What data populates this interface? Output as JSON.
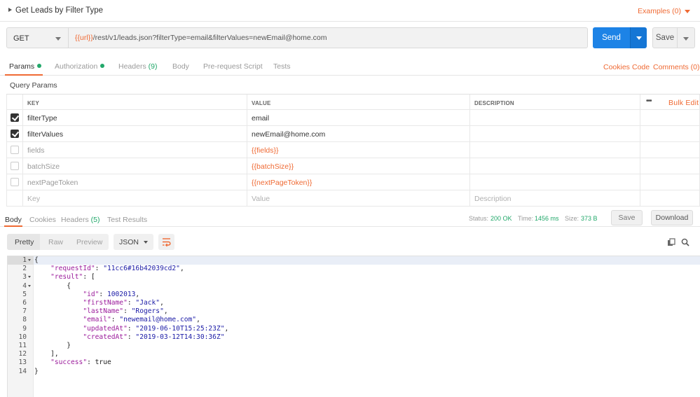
{
  "request": {
    "title": "Get Leads by Filter Type",
    "examples_label": "Examples (0)",
    "method": "GET",
    "url_var": "{{url}}",
    "url_path": "/rest/v1/leads.json?filterType=email&filterValues=newEmail@home.com",
    "send_label": "Send",
    "save_label": "Save"
  },
  "req_tabs": {
    "params": "Params",
    "authorization": "Authorization",
    "headers": "Headers",
    "headers_count": "(9)",
    "body": "Body",
    "prerequest": "Pre-request Script",
    "tests": "Tests",
    "cookies": "Cookies",
    "code": "Code",
    "comments": "Comments (0)"
  },
  "params": {
    "section_label": "Query Params",
    "columns": {
      "key": "KEY",
      "value": "VALUE",
      "description": "DESCRIPTION"
    },
    "more_label": "•••",
    "bulk_edit": "Bulk Edit",
    "rows": [
      {
        "key": "filterType",
        "value": "email",
        "checked": true
      },
      {
        "key": "filterValues",
        "value": "newEmail@home.com",
        "checked": true
      },
      {
        "key": "fields",
        "value": "{{fields}}",
        "checked": false
      },
      {
        "key": "batchSize",
        "value": "{{batchSize}}",
        "checked": false
      },
      {
        "key": "nextPageToken",
        "value": "{{nextPageToken}}",
        "checked": false
      }
    ],
    "placeholder": {
      "key": "Key",
      "value": "Value",
      "description": "Description"
    }
  },
  "response": {
    "tabs": {
      "body": "Body",
      "cookies": "Cookies",
      "headers": "Headers",
      "headers_count": "(5)",
      "test_results": "Test Results"
    },
    "status_label": "Status:",
    "status_value": "200 OK",
    "time_label": "Time:",
    "time_value": "1456 ms",
    "size_label": "Size:",
    "size_value": "373 B",
    "save_label": "Save",
    "download_label": "Download",
    "formats": {
      "pretty": "Pretty",
      "raw": "Raw",
      "preview": "Preview"
    },
    "language": "JSON"
  },
  "code_lines": [
    "{",
    "    \"requestId\": \"11cc6#16b42039cd2\",",
    "    \"result\": [",
    "        {",
    "            \"id\": 1002013,",
    "            \"firstName\": \"Jack\",",
    "            \"lastName\": \"Rogers\",",
    "            \"email\": \"newemail@home.com\",",
    "            \"updatedAt\": \"2019-06-10T15:25:23Z\",",
    "            \"createdAt\": \"2019-03-12T14:30:36Z\"",
    "        }",
    "    ],",
    "    \"success\": true",
    "}"
  ],
  "colors": {
    "accent": "#ef6a34",
    "send": "#1d83e6",
    "status_ok": "#22a86a"
  }
}
